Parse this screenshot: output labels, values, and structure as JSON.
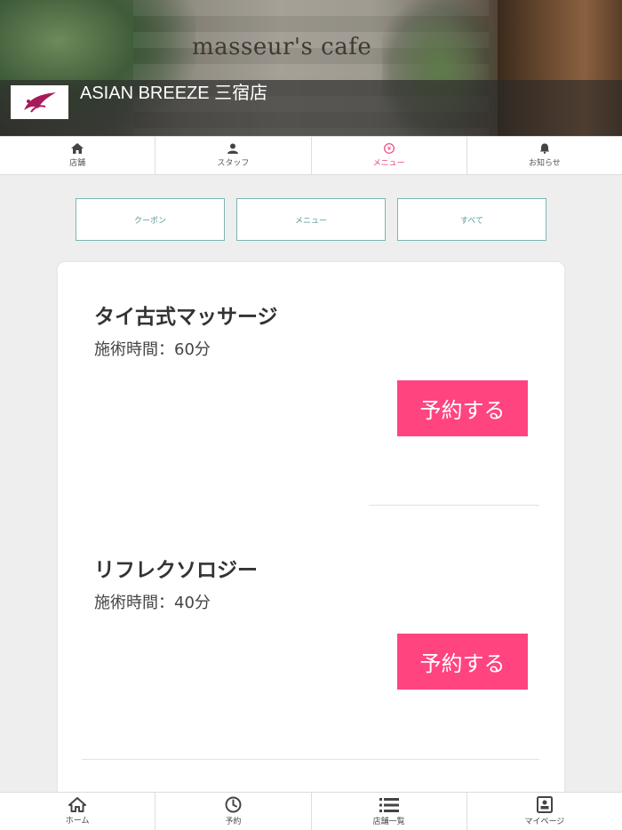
{
  "header": {
    "sign_text": "masseur's cafe",
    "store_name": "ASIAN BREEZE 三宿店"
  },
  "top_tabs": [
    {
      "label": "店舗",
      "icon": "home-icon"
    },
    {
      "label": "スタッフ",
      "icon": "person-icon"
    },
    {
      "label": "メニュー",
      "icon": "yen-icon",
      "active": true
    },
    {
      "label": "お知らせ",
      "icon": "bell-icon"
    }
  ],
  "filters": [
    {
      "label": "クーポン"
    },
    {
      "label": "メニュー"
    },
    {
      "label": "すべて"
    }
  ],
  "menu_items": [
    {
      "name": "タイ古式マッサージ",
      "duration": "施術時間：60分",
      "button": "予約する"
    },
    {
      "name": "リフレクソロジー",
      "duration": "施術時間：40分",
      "button": "予約する"
    }
  ],
  "bottom_nav": [
    {
      "label": "ホーム",
      "icon": "home-icon"
    },
    {
      "label": "予約",
      "icon": "clock-icon"
    },
    {
      "label": "店舗一覧",
      "icon": "list-icon"
    },
    {
      "label": "マイページ",
      "icon": "mypage-icon"
    }
  ],
  "colors": {
    "accent_pink": "#ff4480",
    "active_tab": "#e8437a",
    "filter_border": "#7fb3b3"
  }
}
